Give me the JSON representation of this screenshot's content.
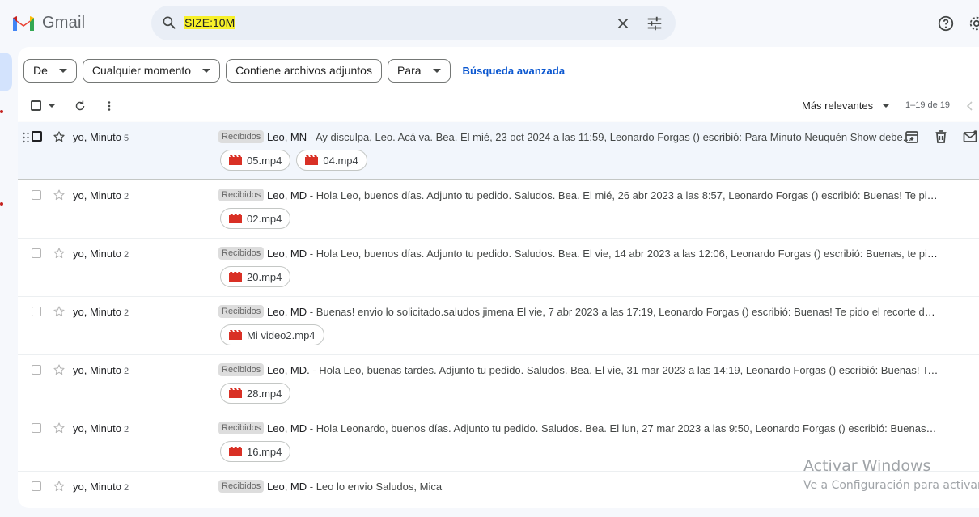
{
  "app": {
    "name": "Gmail"
  },
  "search": {
    "value_prefix": "",
    "value": "SIZE:10M"
  },
  "filters": {
    "chips": [
      {
        "label": "De"
      },
      {
        "label": "Cualquier momento"
      },
      {
        "label": "Contiene archivos adjuntos"
      },
      {
        "label": "Para"
      }
    ],
    "advanced_link": "Búsqueda avanzada"
  },
  "toolbar": {
    "sort_label": "Más relevantes",
    "paging": "1–19 de 19"
  },
  "rows": [
    {
      "sender": "yo, Minuto",
      "count": "5",
      "label": "Recibidos",
      "subject": "Leo, MN",
      "snippet": " - Ay disculpa, Leo. Acá va. Bea. El mié, 23 oct 2024 a las 11:59, Leonardo Forgas () escribió: Para Minuto Neuquén Show debe...",
      "attachments": [
        "05.mp4",
        "04.mp4"
      ]
    },
    {
      "sender": "yo, Minuto",
      "count": "2",
      "label": "Recibidos",
      "subject": "Leo, MD",
      "snippet": " - Hola Leo, buenos días. Adjunto tu pedido. Saludos. Bea. El mié, 26 abr 2023 a las 8:57, Leonardo Forgas () escribió: Buenas! Te pido el...",
      "attachments": [
        "02.mp4"
      ]
    },
    {
      "sender": "yo, Minuto",
      "count": "2",
      "label": "Recibidos",
      "subject": "Leo, MD",
      "snippet": " - Hola Leo, buenos días. Adjunto tu pedido. Saludos. Bea. El vie, 14 abr 2023 a las 12:06, Leonardo Forgas () escribió: Buenas, te pido el...",
      "attachments": [
        "20.mp4"
      ]
    },
    {
      "sender": "yo, Minuto",
      "count": "2",
      "label": "Recibidos",
      "subject": "Leo, MD",
      "snippet": " - Buenas! envio lo solicitado.saludos jimena El vie, 7 abr 2023 a las 17:19, Leonardo Forgas () escribió: Buenas! Te pido el recorte de est...",
      "attachments": [
        "Mi video2.mp4"
      ]
    },
    {
      "sender": "yo, Minuto",
      "count": "2",
      "label": "Recibidos",
      "subject": "Leo, MD.",
      "snippet": " - Hola Leo, buenas tardes. Adjunto tu pedido. Saludos. Bea. El vie, 31 mar 2023 a las 14:19, Leonardo Forgas () escribió: Buenas! Te pid...",
      "attachments": [
        "28.mp4"
      ]
    },
    {
      "sender": "yo, Minuto",
      "count": "2",
      "label": "Recibidos",
      "subject": "Leo, MD",
      "snippet": " - Hola Leonardo, buenos días. Adjunto tu pedido. Saludos. Bea. El lun, 27 mar 2023 a las 9:50, Leonardo Forgas () escribió: Buenas! Te ...",
      "attachments": [
        "16.mp4"
      ]
    },
    {
      "sender": "yo, Minuto",
      "count": "2",
      "label": "Recibidos",
      "subject": "Leo, MD",
      "snippet": " - Leo lo envio Saludos, Mica",
      "attachments": []
    }
  ],
  "watermark": {
    "title": "Activar Windows",
    "subtitle": "Ve a Configuración para activar W"
  },
  "colors": {
    "accent": "#0b57d0",
    "highlight": "#f7f02a",
    "film": "#d93025"
  }
}
